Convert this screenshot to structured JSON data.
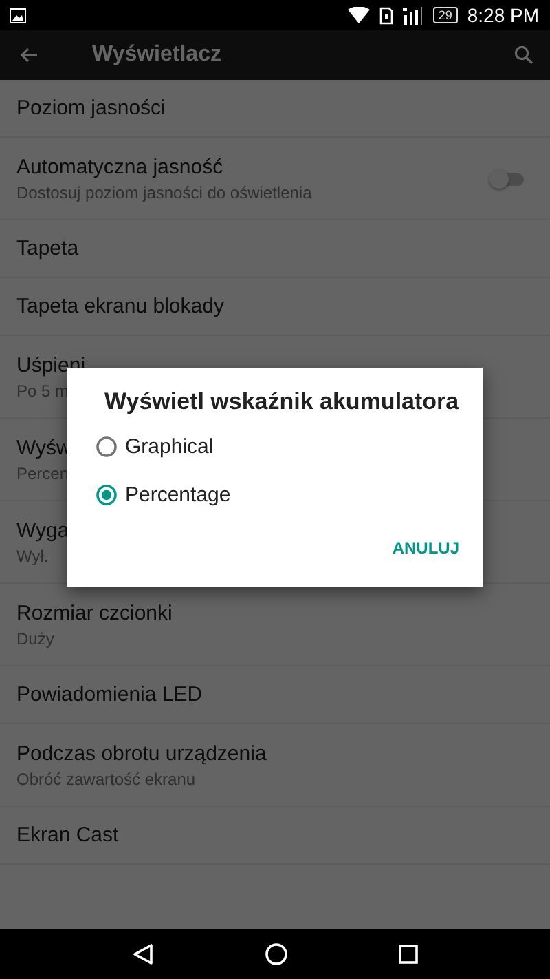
{
  "status_bar": {
    "battery": "29",
    "time": "8:28 PM"
  },
  "app_bar": {
    "title": "Wyświetlacz"
  },
  "settings": [
    {
      "title": "Poziom jasności"
    },
    {
      "title": "Automatyczna jasność",
      "summary": "Dostosuj poziom jasności do oświetlenia",
      "on": false
    },
    {
      "title": "Tapeta"
    },
    {
      "title": "Tapeta ekranu blokady"
    },
    {
      "title": "Uśpieni",
      "summary": "Po 5 m"
    },
    {
      "title": "Wyśw",
      "summary": "Percen"
    },
    {
      "title": "Wyga",
      "summary": "Wył."
    },
    {
      "title": "Rozmiar czcionki",
      "summary": "Duży"
    },
    {
      "title": "Powiadomienia LED"
    },
    {
      "title": "Podczas obrotu urządzenia",
      "summary": "Obróć zawartość ekranu"
    },
    {
      "title": "Ekran Cast"
    }
  ],
  "dialog": {
    "title": "Wyświetl wskaźnik akumulatora",
    "options": [
      {
        "label": "Graphical",
        "selected": false
      },
      {
        "label": "Percentage",
        "selected": true
      }
    ],
    "buttons": [
      "ANULUJ"
    ]
  }
}
